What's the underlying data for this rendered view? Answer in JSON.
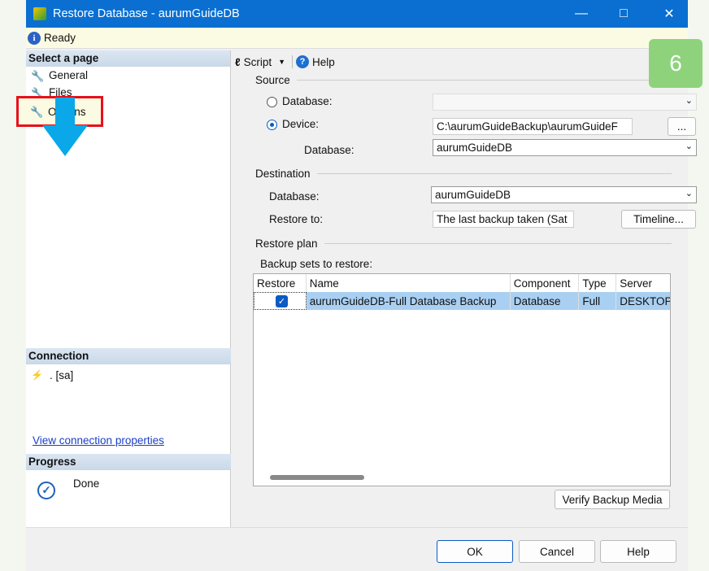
{
  "window": {
    "title": "Restore Database - aurumGuideDB"
  },
  "status": {
    "text": "Ready"
  },
  "sidebar": {
    "header": "Select a page",
    "items": [
      {
        "label": "General"
      },
      {
        "label": "Files"
      },
      {
        "label": "Options",
        "selected": true
      }
    ]
  },
  "connection": {
    "header": "Connection",
    "server": ". [sa]",
    "link": "View connection properties"
  },
  "progress": {
    "header": "Progress",
    "status": "Done"
  },
  "toolbar": {
    "script": "Script",
    "help": "Help"
  },
  "source": {
    "title": "Source",
    "database_label": "Database:",
    "device_label": "Device:",
    "device_value": "C:\\aurumGuideBackup\\aurumGuideF",
    "browse": "...",
    "db_label": "Database:",
    "db_value": "aurumGuideDB",
    "selected": "Device"
  },
  "destination": {
    "title": "Destination",
    "database_label": "Database:",
    "database_value": "aurumGuideDB",
    "restore_to_label": "Restore to:",
    "restore_to_value": "The last backup taken (Sat",
    "timeline": "Timeline..."
  },
  "plan": {
    "title": "Restore plan",
    "sets_label": "Backup sets to restore:",
    "columns": [
      "Restore",
      "Name",
      "Component",
      "Type",
      "Server"
    ],
    "rows": [
      {
        "restore": true,
        "name": "aurumGuideDB-Full Database Backup",
        "component": "Database",
        "type": "Full",
        "server": "DESKTOP"
      }
    ],
    "verify": "Verify Backup Media"
  },
  "buttons": {
    "ok": "OK",
    "cancel": "Cancel",
    "help": "Help"
  },
  "badge": "6",
  "colors": {
    "titlebar": "#0a6fd1",
    "highlight": "#e8101a",
    "arrow": "#0aa8e8",
    "badge": "#8ed37b"
  }
}
